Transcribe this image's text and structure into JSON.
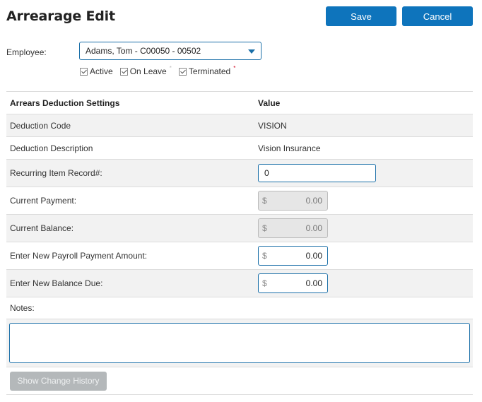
{
  "header": {
    "title": "Arrearage Edit",
    "save_label": "Save",
    "cancel_label": "Cancel"
  },
  "employee": {
    "label": "Employee:",
    "selected": "Adams, Tom  - C00050 - 00502",
    "filters": [
      {
        "label": "Active",
        "checked": true,
        "marker": ""
      },
      {
        "label": "On Leave",
        "checked": true,
        "marker": "*"
      },
      {
        "label": "Terminated",
        "checked": true,
        "marker": "*"
      }
    ]
  },
  "table": {
    "headers": [
      "Arrears Deduction Settings",
      "Value"
    ],
    "rows": {
      "deduction_code": {
        "label": "Deduction Code",
        "value": "VISION"
      },
      "deduction_description": {
        "label": "Deduction Description",
        "value": "Vision Insurance"
      },
      "recurring_item_record": {
        "label": "Recurring Item Record#:",
        "value": "0"
      },
      "current_payment": {
        "label": "Current Payment:",
        "currency": "$",
        "value": "0.00"
      },
      "current_balance": {
        "label": "Current Balance:",
        "currency": "$",
        "value": "0.00"
      },
      "new_payroll_payment": {
        "label": "Enter New Payroll Payment Amount:",
        "currency": "$",
        "value": "0.00"
      },
      "new_balance_due": {
        "label": "Enter New Balance Due:",
        "currency": "$",
        "value": "0.00"
      }
    }
  },
  "notes": {
    "label": "Notes:",
    "value": ""
  },
  "history": {
    "button_label": "Show Change History"
  },
  "colors": {
    "primary": "#0e74bc",
    "input_border": "#1a6fa8",
    "disabled_button": "#b4b8ba",
    "required_marker": "#d0021b"
  }
}
